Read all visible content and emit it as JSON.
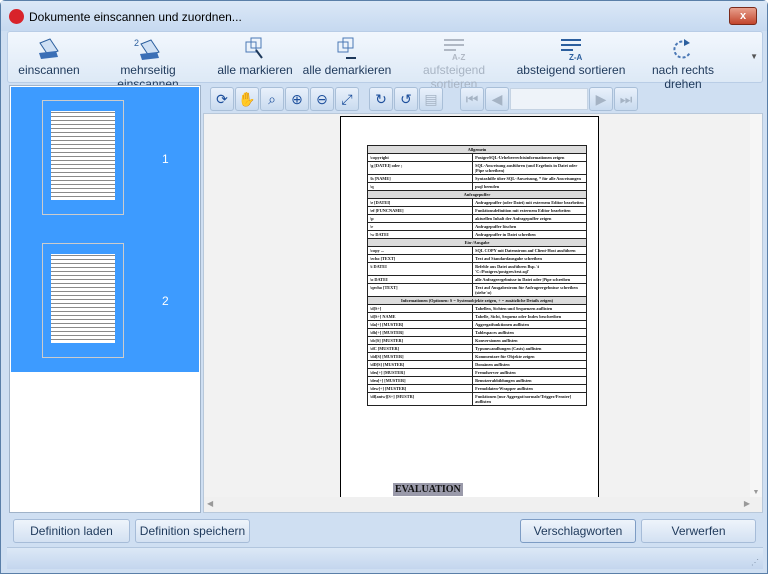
{
  "window": {
    "title": "Dokumente einscannen und zuordnen...",
    "close_label": "x"
  },
  "toolbar": {
    "items": [
      {
        "label": "einscannen",
        "icon": "scanner-icon",
        "enabled": true
      },
      {
        "label": "mehrseitig einscannen",
        "icon": "multi-scan-icon",
        "badge": "2",
        "enabled": true
      },
      {
        "label": "alle markieren",
        "icon": "select-all-icon",
        "enabled": true
      },
      {
        "label": "alle demarkieren",
        "icon": "deselect-all-icon",
        "enabled": true
      },
      {
        "label": "aufsteigend sortieren",
        "icon": "sort-ascending-icon",
        "badge": "A-Z",
        "enabled": false
      },
      {
        "label": "absteigend sortieren",
        "icon": "sort-descending-icon",
        "badge": "Z-A",
        "enabled": true
      },
      {
        "label": "nach rechts drehen",
        "icon": "rotate-right-icon",
        "enabled": true
      }
    ]
  },
  "thumbnails": [
    {
      "number": "1"
    },
    {
      "number": "2"
    }
  ],
  "viewer": {
    "page_value": ""
  },
  "document": {
    "rows": [
      {
        "h": "Allgemein"
      },
      {
        "c": "\\copyright",
        "d": "PostgreSQL-Urheberrechtsinformationen zeigen"
      },
      {
        "c": "\\g [DATEI] oder ;",
        "d": "SQL-Anweisung ausführen (und Ergebnis in Datei oder |Pipe schreiben)"
      },
      {
        "c": "\\h [NAME]",
        "d": "Syntaxhilfe über SQL-Anweisung, * für alle Anweisungen"
      },
      {
        "c": "\\q",
        "d": "psql beenden"
      },
      {
        "h": "Anfragepuffer"
      },
      {
        "c": "\\e [DATEI]",
        "d": "Anfragepuffer (oder Datei) mit externem Editor bearbeiten"
      },
      {
        "c": "\\ef [FUNCNAME]",
        "d": "Funktionsdefinition mit externem Editor bearbeiten"
      },
      {
        "c": "\\p",
        "d": "aktuellen Inhalt der Anfragepuffer zeigen"
      },
      {
        "c": "\\r",
        "d": "Anfragepuffer löschen"
      },
      {
        "c": "\\w DATEI",
        "d": "Anfragepuffer in Datei schreiben"
      },
      {
        "h": "Ein-/Ausgabe"
      },
      {
        "c": "\\copy ...",
        "d": "SQL COPY mit Datenstrom auf Client-Host ausführen"
      },
      {
        "c": "\\echo [TEXT]",
        "d": "Text auf Standardausgabe schreiben"
      },
      {
        "c": "\\i DATEI",
        "d": "Befehle aus Datei ausführen Bsp. \\i 'C:/Postgres/postgres/test.sql'"
      },
      {
        "c": "\\o DATEI",
        "d": "alle Anfrageergebnisse in Datei oder |Pipe schreiben"
      },
      {
        "c": "\\qecho [TEXT]",
        "d": "Text auf Ausgabestrom für Anfrageergebnisse schreiben (siehe \\o)"
      },
      {
        "h": "Informationen (Optionen: S = Systemobjekte zeigen, + = zusätzliche Details zeigen)"
      },
      {
        "c": "\\d[S+]",
        "d": "Tabellen, Sichten und Sequenzen auflisten"
      },
      {
        "c": "\\d[S+] NAME",
        "d": "Tabelle, Sicht, Sequenz oder Index beschreiben"
      },
      {
        "c": "\\da[+] [MUSTER]",
        "d": "Aggregatfunktionen auflisten"
      },
      {
        "c": "\\db[+] [MUSTER]",
        "d": "Tablespaces auflisten"
      },
      {
        "c": "\\dc[S] [MUSTER]",
        "d": "Konversionen auflisten"
      },
      {
        "c": "\\dC [MUSTER]",
        "d": "Typumwandlungen (Casts) auflisten"
      },
      {
        "c": "\\dd[S] [MUSTER]",
        "d": "Kommentare für Objekte zeigen"
      },
      {
        "c": "\\dD[S] [MUSTER]",
        "d": "Domänen auflisten"
      },
      {
        "c": "\\des[+] [MUSTER]",
        "d": "Fremdserver auflisten"
      },
      {
        "c": "\\deu[+] [MUSTER]",
        "d": "Benutzerabbildungen auflisten"
      },
      {
        "c": "\\dew[+] [MUSTER]",
        "d": "Fremddaten-Wrapper auflisten"
      },
      {
        "c": "\\df[antw][S+] [MUSTR]",
        "d": "Funktionen [nur Aggregat/normale/Trigger/Fenster] auflisten"
      }
    ],
    "watermark": "EVALUATION"
  },
  "buttons": {
    "load": "Definition laden",
    "save": "Definition speichern",
    "tag": "Verschlagworten",
    "discard": "Verwerfen"
  }
}
